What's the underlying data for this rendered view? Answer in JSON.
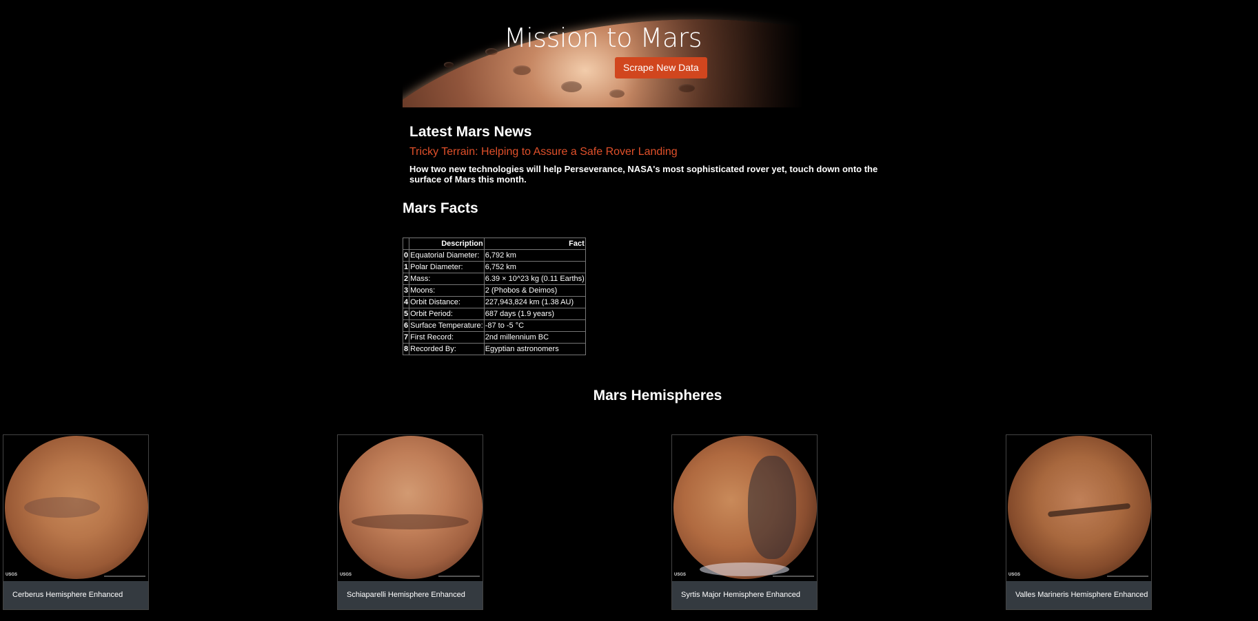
{
  "hero": {
    "title": "Mission to Mars",
    "scrape_button": "Scrape New Data"
  },
  "news": {
    "heading": "Latest Mars News",
    "title": "Tricky Terrain: Helping to Assure a Safe Rover Landing",
    "teaser": "How two new technologies will help Perseverance, NASA's most sophisticated rover yet, touch down onto the surface of Mars this month."
  },
  "facts": {
    "heading": "Mars Facts",
    "columns": [
      "",
      "Description",
      "Fact"
    ],
    "rows": [
      {
        "index": "0",
        "description": "Equatorial Diameter:",
        "fact": "6,792 km"
      },
      {
        "index": "1",
        "description": "Polar Diameter:",
        "fact": "6,752 km"
      },
      {
        "index": "2",
        "description": "Mass:",
        "fact": "6.39 × 10^23 kg (0.11 Earths)"
      },
      {
        "index": "3",
        "description": "Moons:",
        "fact": "2 (Phobos & Deimos)"
      },
      {
        "index": "4",
        "description": "Orbit Distance:",
        "fact": "227,943,824 km (1.38 AU)"
      },
      {
        "index": "5",
        "description": "Orbit Period:",
        "fact": "687 days (1.9 years)"
      },
      {
        "index": "6",
        "description": "Surface Temperature:",
        "fact": "-87 to -5 °C"
      },
      {
        "index": "7",
        "description": "First Record:",
        "fact": "2nd millennium BC"
      },
      {
        "index": "8",
        "description": "Recorded By:",
        "fact": "Egyptian astronomers"
      }
    ]
  },
  "hemispheres": {
    "heading": "Mars Hemispheres",
    "logo_text": "USGS",
    "items": [
      {
        "title": "Cerberus Hemisphere Enhanced"
      },
      {
        "title": "Schiaparelli Hemisphere Enhanced"
      },
      {
        "title": "Syrtis Major Hemisphere Enhanced"
      },
      {
        "title": "Valles Marineris Hemisphere Enhanced"
      }
    ]
  },
  "colors": {
    "accent": "#d1461e",
    "news_title": "#e0502a",
    "card_footer": "#343a40",
    "background": "#000000"
  }
}
